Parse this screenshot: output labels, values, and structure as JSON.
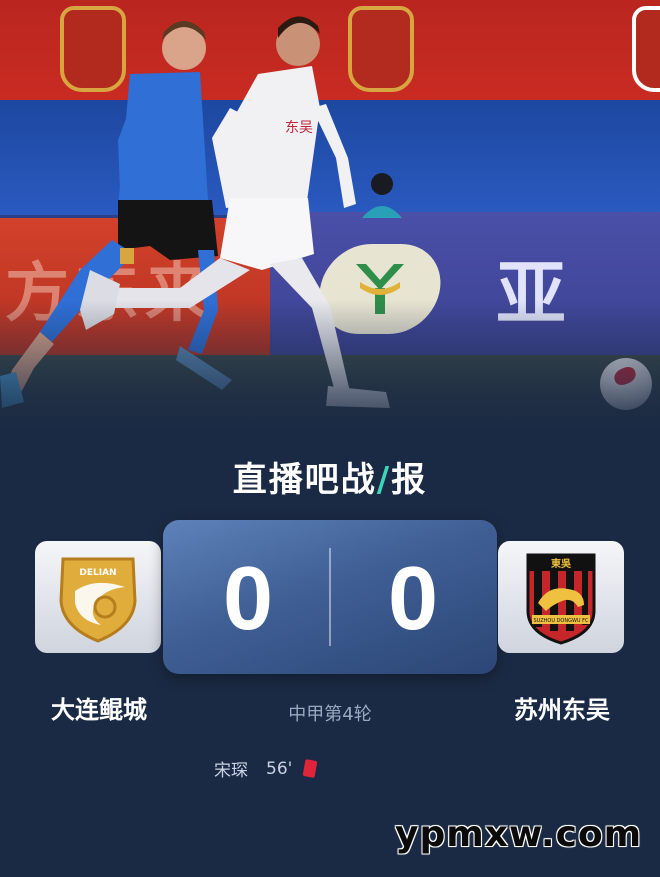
{
  "hero": {
    "ad_left_text": "方东来",
    "ad_right_text": "亚细",
    "jersey_text": "东吴"
  },
  "brand": {
    "part1": "直播吧战",
    "slash": "/",
    "part2": "报"
  },
  "match": {
    "home_team": "大连鲲城",
    "away_team": "苏州东吴",
    "home_score": "0",
    "away_score": "0",
    "round": "中甲第4轮",
    "home_badge_text": "DELIAN",
    "away_badge_text": "東吳",
    "away_badge_subtext": "SUZHOU DONGWU FC"
  },
  "events": [
    {
      "player": "宋琛",
      "minute": "56'",
      "type": "red-card"
    }
  ],
  "watermark": "ypmxw.com",
  "colors": {
    "background": "#1b2a44",
    "score_panel": "#4a6aa3",
    "accent": "#3ed4b8",
    "red_card": "#e0243a"
  }
}
